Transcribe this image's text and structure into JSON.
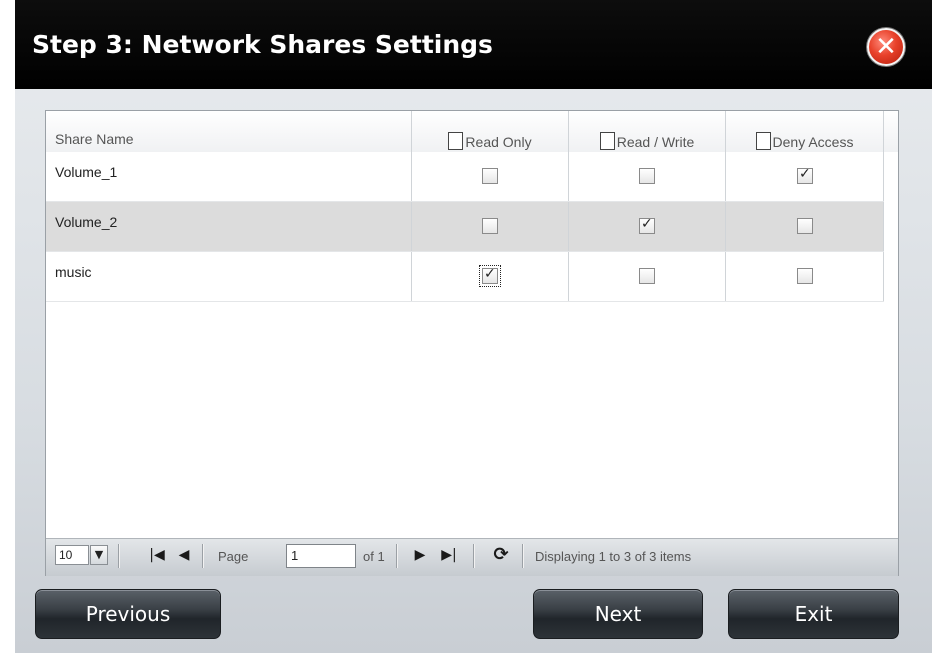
{
  "dialog": {
    "title": "Step 3: Network Shares Settings",
    "close_glyph": "✕"
  },
  "grid": {
    "columns": [
      "Share Name",
      "Read Only",
      "Read / Write",
      "Deny Access"
    ],
    "rows": [
      {
        "name": "Volume_1",
        "read_only": false,
        "read_write": false,
        "deny_access": true
      },
      {
        "name": "Volume_2",
        "read_only": false,
        "read_write": true,
        "deny_access": false
      },
      {
        "name": "music",
        "read_only": true,
        "read_write": false,
        "deny_access": false
      }
    ]
  },
  "pager": {
    "page_size": "10",
    "page_label": "Page",
    "page_value": "1",
    "of_label": "of 1",
    "display_text": "Displaying 1 to 3 of 3 items",
    "icons": {
      "dropdown": "chevron-down-icon",
      "first": "first-page-icon",
      "prev": "previous-page-icon",
      "next": "next-page-icon",
      "last": "last-page-icon",
      "refresh": "refresh-icon"
    }
  },
  "footer": {
    "previous_label": "Previous",
    "next_label": "Next",
    "exit_label": "Exit"
  },
  "colors": {
    "titlebar": "#000000",
    "close_button": "#e8412a",
    "alt_row": "#dcdcdc",
    "button": "#2d3338"
  }
}
